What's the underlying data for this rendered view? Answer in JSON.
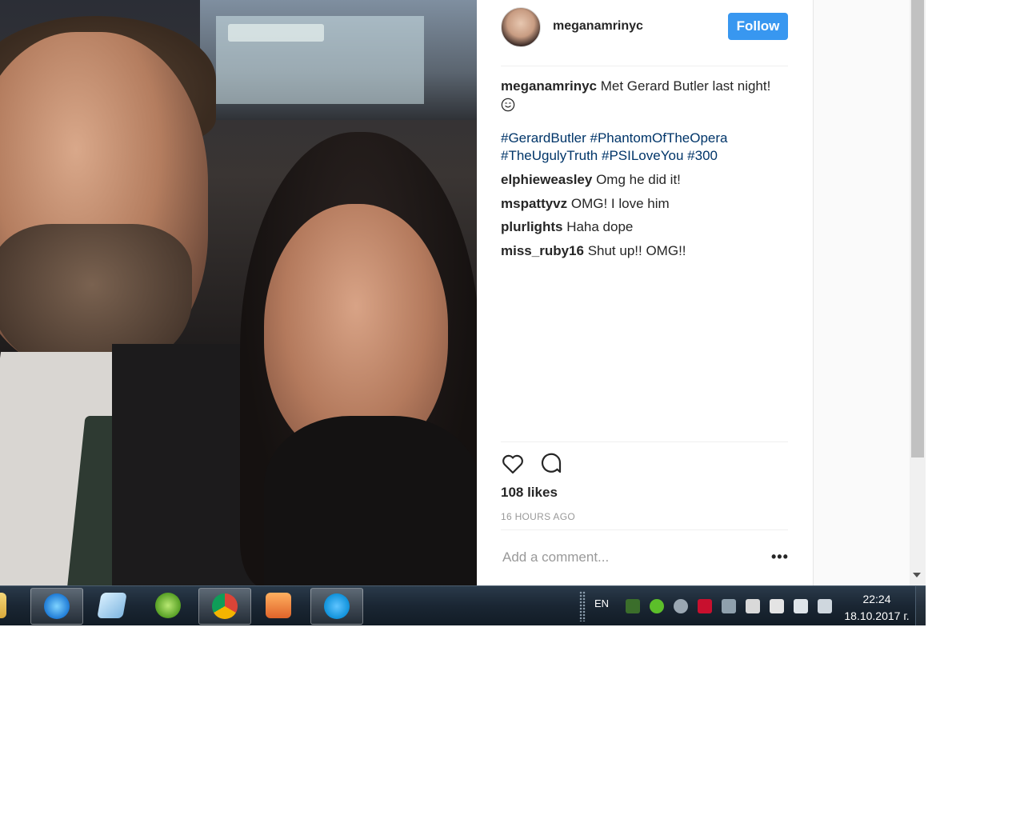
{
  "post": {
    "username": "meganamrinyc",
    "follow_label": "Follow",
    "caption_user": "meganamrinyc",
    "caption_text": "Met Gerard Butler last night!",
    "hashtags": [
      "#GerardButler",
      "#PhantomOfTheOpera",
      "#TheUgulyTruth",
      "#PSILoveYou",
      "#300"
    ],
    "comments": [
      {
        "user": "elphieweasley",
        "text": "Omg he did it!"
      },
      {
        "user": "mspattyvz",
        "text": "OMG! I love him"
      },
      {
        "user": "plurlights",
        "text": "Haha dope"
      },
      {
        "user": "miss_ruby16",
        "text": "Shut up!! OMG!!"
      }
    ],
    "likes": "108 likes",
    "time_ago": "16 HOURS AGO",
    "comment_placeholder": "Add a comment...",
    "more_label": "•••"
  },
  "icons": {
    "like": "heart-icon",
    "comment": "comment-bubble-icon"
  },
  "colors": {
    "follow_button": "#3897f0",
    "hashtag": "#003569"
  },
  "taskbar": {
    "apps": [
      "file-explorer-icon",
      "internet-explorer-icon",
      "notepad-icon",
      "utorrent-icon",
      "chrome-icon",
      "media-player-icon",
      "skype-icon"
    ],
    "language": "EN",
    "time": "22:24",
    "date": "18.10.2017 г."
  }
}
